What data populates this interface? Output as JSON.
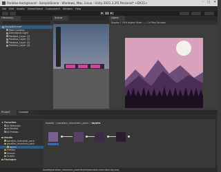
{
  "window": {
    "title": "Parallax background - SampleScene - Windows, Mac, Linux - Unity 2021.3.2f1 Personal* <DX11>",
    "controls": [
      "–",
      "□",
      "✕"
    ]
  },
  "menu": [
    "File",
    "Edit",
    "Assets",
    "GameObject",
    "Component",
    "Window",
    "Help"
  ],
  "hierarchy": {
    "tab": "Hierarchy",
    "items": [
      {
        "label": "SampleScene*",
        "selected": true
      },
      {
        "label": "Main Camera"
      },
      {
        "label": "Directional Light"
      },
      {
        "label": "Parallax_Layer (1)"
      },
      {
        "label": "Parallax_Layer (2)"
      },
      {
        "label": "Parallax_Layer (3)"
      },
      {
        "label": "Parallax_Layer (4)"
      }
    ]
  },
  "scene": {
    "tab": "Scene"
  },
  "game": {
    "tab": "Game",
    "toolbar": "Display 1   16:9 Aspect   Scale ——  1x  Play Focused"
  },
  "project": {
    "tabs": [
      "Project",
      "Console"
    ],
    "tree": [
      {
        "label": "Favorites",
        "type": "star"
      },
      {
        "label": "All Materials",
        "type": "search"
      },
      {
        "label": "All Models",
        "type": "search"
      },
      {
        "label": "All Prefabs",
        "type": "search"
      },
      {
        "label": "Assets",
        "type": "folder"
      },
      {
        "label": "parallax_industrial_pack",
        "type": "folder"
      },
      {
        "label": "parallax_mountain_pack",
        "type": "folder"
      },
      {
        "label": "layers",
        "type": "folder",
        "selected": true
      },
      {
        "label": "Prefabs",
        "type": "folder"
      },
      {
        "label": "Scenes",
        "type": "folder"
      },
      {
        "label": "Scripts",
        "type": "folder"
      },
      {
        "label": "Packages",
        "type": "folder"
      }
    ],
    "breadcrumb": [
      "Assets",
      "parallax_mountain_pack",
      "layers"
    ],
    "status_path": "Assets/parallax_mountain_pack/layers/parallax-mountain-bg.png"
  }
}
